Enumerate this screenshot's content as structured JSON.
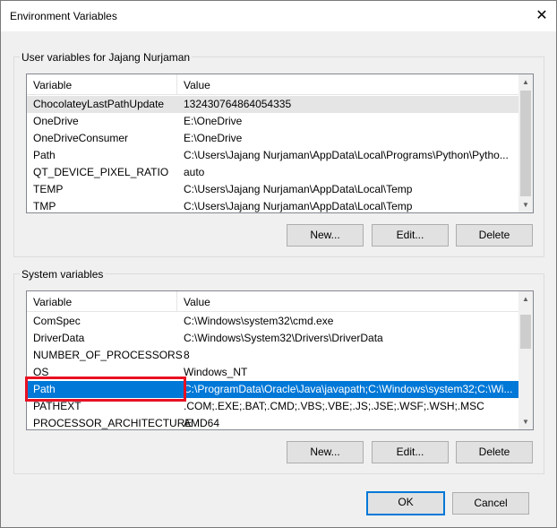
{
  "window": {
    "title": "Environment Variables",
    "close": "✕"
  },
  "user_vars": {
    "group_label": "User variables for Jajang Nurjaman",
    "columns": [
      "Variable",
      "Value"
    ],
    "rows": [
      [
        "ChocolateyLastPathUpdate",
        "132430764864054335"
      ],
      [
        "OneDrive",
        "E:\\OneDrive"
      ],
      [
        "OneDriveConsumer",
        "E:\\OneDrive"
      ],
      [
        "Path",
        "C:\\Users\\Jajang Nurjaman\\AppData\\Local\\Programs\\Python\\Pytho..."
      ],
      [
        "QT_DEVICE_PIXEL_RATIO",
        "auto"
      ],
      [
        "TEMP",
        "C:\\Users\\Jajang Nurjaman\\AppData\\Local\\Temp"
      ],
      [
        "TMP",
        "C:\\Users\\Jajang Nurjaman\\AppData\\Local\\Temp"
      ]
    ],
    "buttons": {
      "new": "New...",
      "edit": "Edit...",
      "delete": "Delete"
    }
  },
  "system_vars": {
    "group_label": "System variables",
    "columns": [
      "Variable",
      "Value"
    ],
    "rows": [
      [
        "ComSpec",
        "C:\\Windows\\system32\\cmd.exe"
      ],
      [
        "DriverData",
        "C:\\Windows\\System32\\Drivers\\DriverData"
      ],
      [
        "NUMBER_OF_PROCESSORS",
        "8"
      ],
      [
        "OS",
        "Windows_NT"
      ],
      [
        "Path",
        "C:\\ProgramData\\Oracle\\Java\\javapath;C:\\Windows\\system32;C:\\Wi..."
      ],
      [
        "PATHEXT",
        ".COM;.EXE;.BAT;.CMD;.VBS;.VBE;.JS;.JSE;.WSF;.WSH;.MSC"
      ],
      [
        "PROCESSOR_ARCHITECTURE",
        "AMD64"
      ]
    ],
    "buttons": {
      "new": "New...",
      "edit": "Edit...",
      "delete": "Delete"
    }
  },
  "footer": {
    "ok": "OK",
    "cancel": "Cancel"
  },
  "colors": {
    "selection": "#0078d7",
    "highlight_box": "#e81123"
  }
}
